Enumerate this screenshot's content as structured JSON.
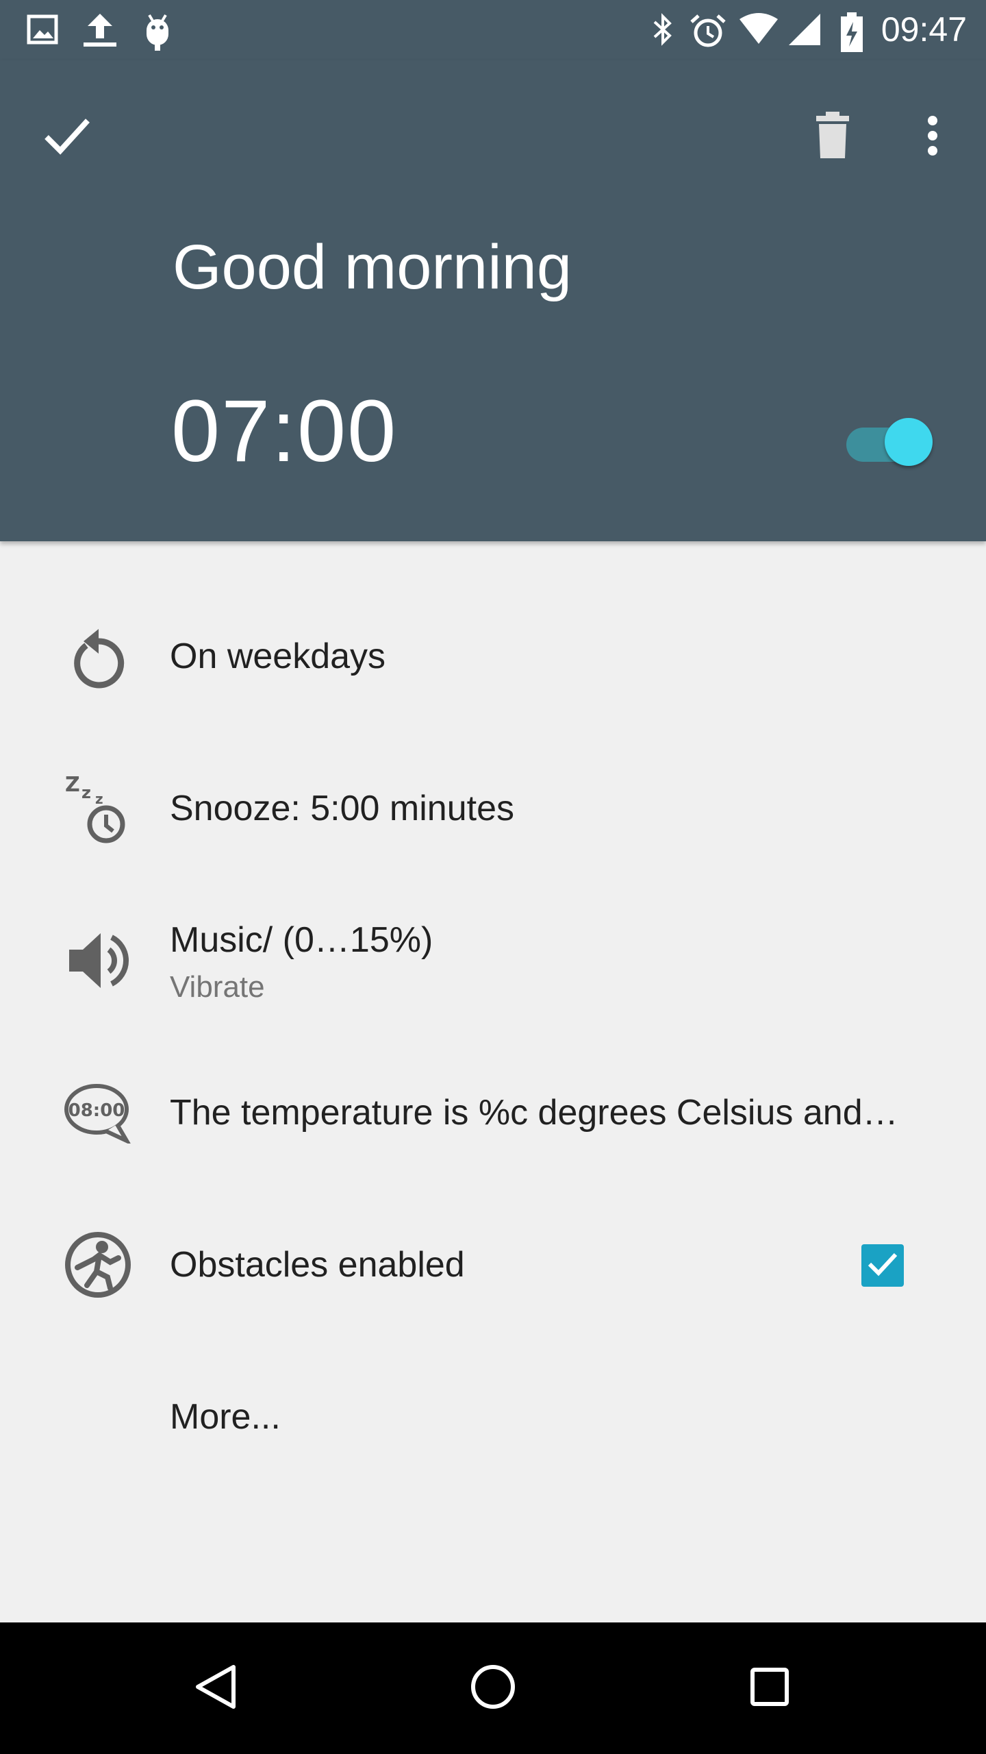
{
  "status_bar": {
    "time": "09:47",
    "left_icons": [
      "image-icon",
      "upload-icon",
      "android-icon"
    ],
    "right_icons": [
      "bluetooth-icon",
      "alarm-clock-icon",
      "wifi-icon",
      "signal-icon",
      "battery-icon"
    ]
  },
  "header": {
    "alarm_name": "Good morning",
    "alarm_time": "07:00",
    "enabled": true,
    "colors": {
      "background": "#475a66",
      "accent": "#3fd8ee"
    }
  },
  "settings": {
    "repeat": {
      "label": "On weekdays",
      "icon": "repeat-icon"
    },
    "snooze": {
      "label": "Snooze: 5:00 minutes",
      "icon": "snooze-icon"
    },
    "sound": {
      "label": "Music/ (0…15%)",
      "sublabel": "Vibrate",
      "icon": "volume-icon"
    },
    "speech": {
      "label": "The temperature is %c degrees Celsius and…",
      "icon": "speech-bubble-icon",
      "icon_text": "08:00"
    },
    "obstacles": {
      "label": "Obstacles enabled",
      "checked": true,
      "icon": "obstacle-icon"
    },
    "more": {
      "label": "More..."
    }
  },
  "nav_bar": {
    "buttons": [
      "back-icon",
      "home-icon",
      "recents-icon"
    ]
  }
}
